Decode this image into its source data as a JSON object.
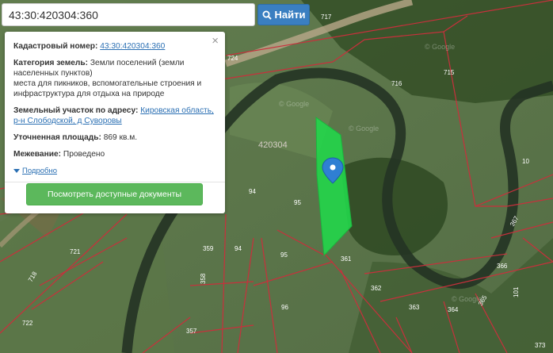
{
  "search": {
    "value": "43:30:420304:360",
    "button_label": "Найти"
  },
  "popup": {
    "cadastral_label": "Кадастровый номер:",
    "cadastral_value": "43:30:420304:360",
    "category_label": "Категория земель:",
    "category_value": "Земли поселений (земли населенных пунктов)",
    "use_value": "места для пикников, вспомогательные строения и инфраструктура для отдыха на природе",
    "address_label": "Земельный участок по адресу:",
    "address_value": "Кировская область, р-н Слободской, д Суворовы",
    "area_label": "Уточненная площадь:",
    "area_value": "869 кв.м.",
    "survey_label": "Межевание:",
    "survey_value": "Проведено",
    "more_label": "Подробно",
    "docs_button": "Посмотреть доступные документы",
    "close_glyph": "×"
  },
  "map": {
    "quarter_label": "420304",
    "parcels": [
      "717",
      "724",
      "716",
      "715",
      "94",
      "95",
      "95",
      "359",
      "94",
      "361",
      "721",
      "358",
      "96",
      "362",
      "363",
      "364",
      "365",
      "366",
      "367",
      "10",
      "101",
      "718",
      "722",
      "357",
      "373"
    ],
    "watermarks": [
      "© Google",
      "© Google",
      "© Google",
      "© Google"
    ],
    "highlight_color": "#22d64a",
    "boundary_color": "#c8303c"
  }
}
